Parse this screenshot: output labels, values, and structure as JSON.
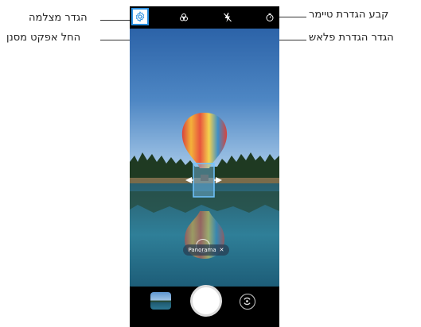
{
  "callouts": {
    "settings": "הגדר מצלמה",
    "filter": "החל אפקט מסנן",
    "flash": "הגדר הגדרת פלאש",
    "timer": "קבע הגדרת טיימר"
  },
  "viewfinder": {
    "mode_chip_label": "Panorama",
    "mode_chip_close": "✕"
  },
  "icons": {
    "settings": "gear-icon",
    "filter": "filter-icon",
    "flash": "flash-off-icon",
    "timer": "timer-icon",
    "gallery": "gallery-thumbnail",
    "shutter": "shutter-button",
    "switch_camera": "switch-camera-icon"
  },
  "colors": {
    "highlight": "#2a8fe0"
  }
}
